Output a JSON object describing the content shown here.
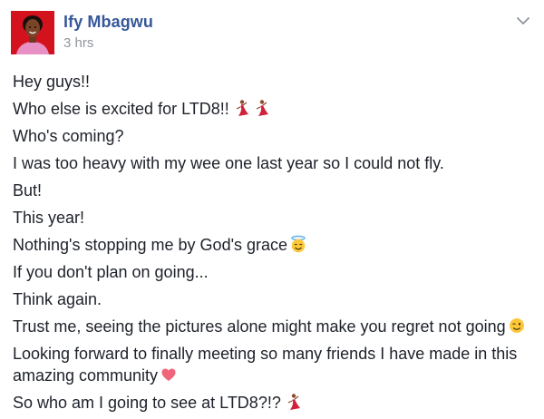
{
  "post": {
    "author": "Ify Mbagwu",
    "time": "3 hrs",
    "avatar_icon": "profile-photo",
    "menu_icon": "chevron-down-icon",
    "lines": [
      "Hey guys!!",
      "Who else is excited for LTD8!!",
      "Who's coming?",
      "I was too heavy with my wee one last year so I could not fly.",
      "But!",
      "This year!",
      "Nothing's stopping me by God's grace",
      "If you don't plan on going...",
      "Think again.",
      "Trust me, seeing the pictures alone might make you regret not going",
      "Looking forward to finally meeting so many friends I have made in this amazing community",
      "So who am I going to see at LTD8?!?"
    ],
    "emojis": {
      "dancer": "dancer-emoji",
      "halo": "smiling-face-with-halo-emoji",
      "wink": "winking-face-emoji",
      "heart": "red-heart-emoji"
    },
    "colors": {
      "author": "#365899",
      "time": "#90949c",
      "text": "#1d2129",
      "avatar_bg": "#d3121d"
    }
  }
}
